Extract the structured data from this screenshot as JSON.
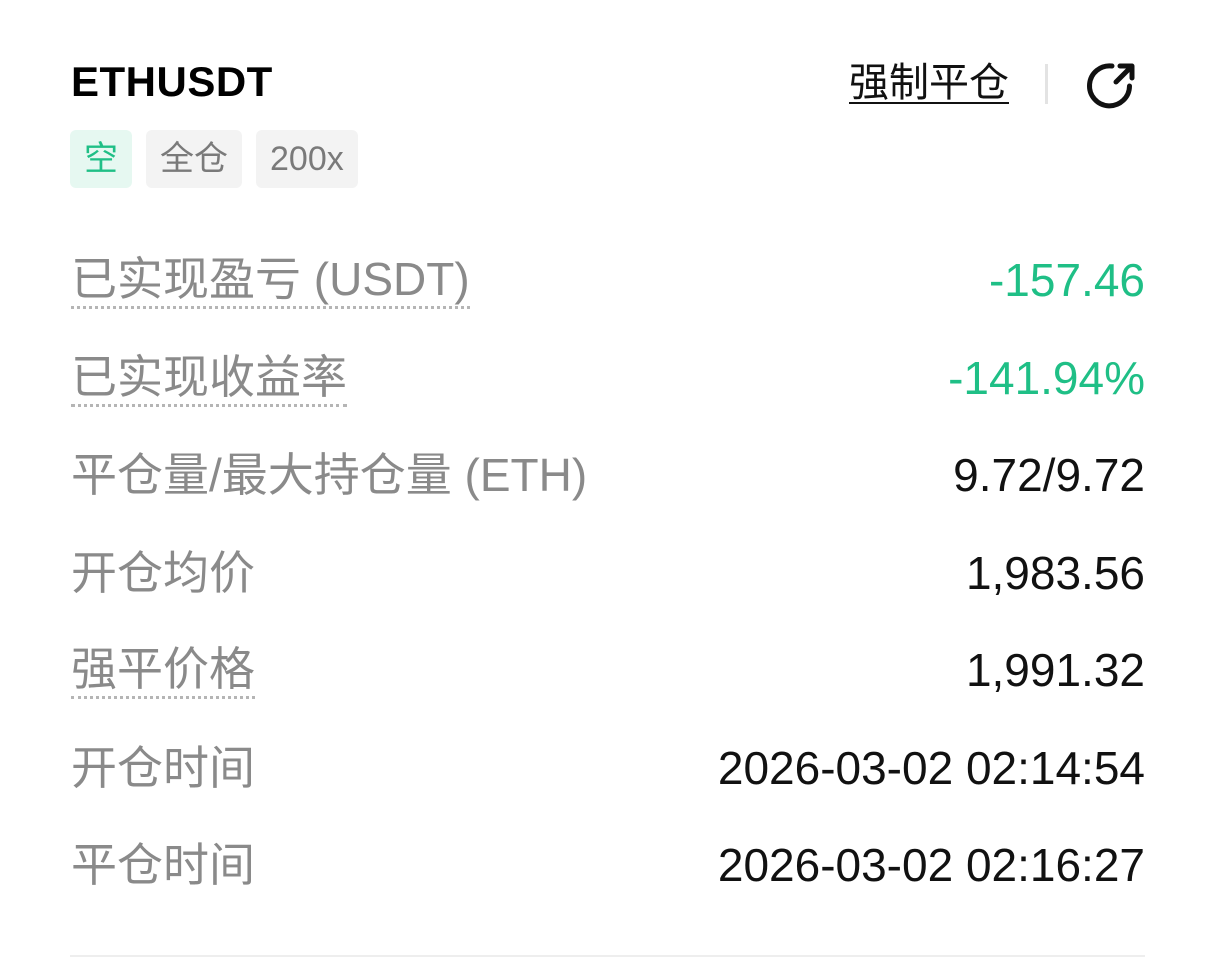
{
  "header": {
    "symbol": "ETHUSDT",
    "force_close_label": "强制平仓"
  },
  "tags": {
    "side": "空",
    "margin_mode": "全仓",
    "leverage": "200x"
  },
  "rows": [
    {
      "label": "已实现盈亏 (USDT)",
      "value": "-157.46"
    },
    {
      "label": "已实现收益率",
      "value": "-141.94%"
    },
    {
      "label": "平仓量/最大持仓量 (ETH)",
      "value": "9.72/9.72"
    },
    {
      "label": "开仓均价",
      "value": "1,983.56"
    },
    {
      "label": "强平价格",
      "value": "1,991.32"
    },
    {
      "label": "开仓时间",
      "value": "2026-03-02 02:14:54"
    },
    {
      "label": "平仓时间",
      "value": "2026-03-02 02:16:27"
    }
  ],
  "icons": {
    "share": "share-icon"
  },
  "colors": {
    "profit_negative": "#1fbf86",
    "side_tag_bg": "#e6f8f1",
    "label_gray": "#8a8a8a"
  }
}
